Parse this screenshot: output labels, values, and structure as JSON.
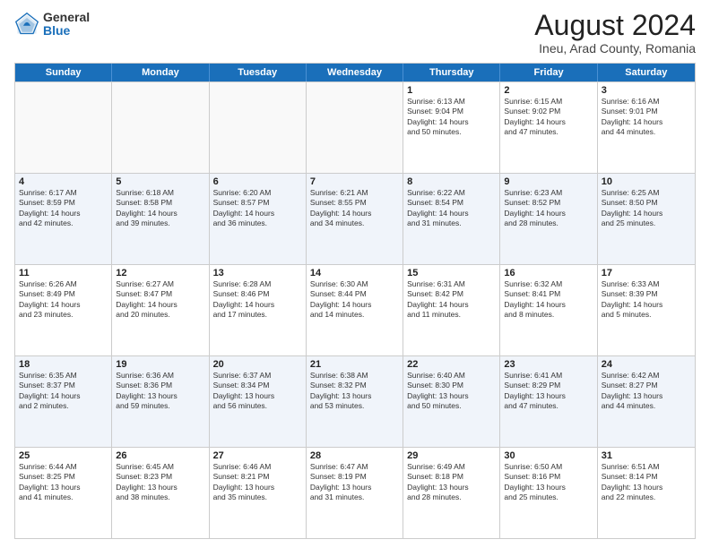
{
  "logo": {
    "general": "General",
    "blue": "Blue"
  },
  "title": "August 2024",
  "location": "Ineu, Arad County, Romania",
  "header_days": [
    "Sunday",
    "Monday",
    "Tuesday",
    "Wednesday",
    "Thursday",
    "Friday",
    "Saturday"
  ],
  "rows": [
    [
      {
        "day": "",
        "info": "",
        "empty": true
      },
      {
        "day": "",
        "info": "",
        "empty": true
      },
      {
        "day": "",
        "info": "",
        "empty": true
      },
      {
        "day": "",
        "info": "",
        "empty": true
      },
      {
        "day": "1",
        "info": "Sunrise: 6:13 AM\nSunset: 9:04 PM\nDaylight: 14 hours\nand 50 minutes."
      },
      {
        "day": "2",
        "info": "Sunrise: 6:15 AM\nSunset: 9:02 PM\nDaylight: 14 hours\nand 47 minutes."
      },
      {
        "day": "3",
        "info": "Sunrise: 6:16 AM\nSunset: 9:01 PM\nDaylight: 14 hours\nand 44 minutes."
      }
    ],
    [
      {
        "day": "4",
        "info": "Sunrise: 6:17 AM\nSunset: 8:59 PM\nDaylight: 14 hours\nand 42 minutes."
      },
      {
        "day": "5",
        "info": "Sunrise: 6:18 AM\nSunset: 8:58 PM\nDaylight: 14 hours\nand 39 minutes."
      },
      {
        "day": "6",
        "info": "Sunrise: 6:20 AM\nSunset: 8:57 PM\nDaylight: 14 hours\nand 36 minutes."
      },
      {
        "day": "7",
        "info": "Sunrise: 6:21 AM\nSunset: 8:55 PM\nDaylight: 14 hours\nand 34 minutes."
      },
      {
        "day": "8",
        "info": "Sunrise: 6:22 AM\nSunset: 8:54 PM\nDaylight: 14 hours\nand 31 minutes."
      },
      {
        "day": "9",
        "info": "Sunrise: 6:23 AM\nSunset: 8:52 PM\nDaylight: 14 hours\nand 28 minutes."
      },
      {
        "day": "10",
        "info": "Sunrise: 6:25 AM\nSunset: 8:50 PM\nDaylight: 14 hours\nand 25 minutes."
      }
    ],
    [
      {
        "day": "11",
        "info": "Sunrise: 6:26 AM\nSunset: 8:49 PM\nDaylight: 14 hours\nand 23 minutes."
      },
      {
        "day": "12",
        "info": "Sunrise: 6:27 AM\nSunset: 8:47 PM\nDaylight: 14 hours\nand 20 minutes."
      },
      {
        "day": "13",
        "info": "Sunrise: 6:28 AM\nSunset: 8:46 PM\nDaylight: 14 hours\nand 17 minutes."
      },
      {
        "day": "14",
        "info": "Sunrise: 6:30 AM\nSunset: 8:44 PM\nDaylight: 14 hours\nand 14 minutes."
      },
      {
        "day": "15",
        "info": "Sunrise: 6:31 AM\nSunset: 8:42 PM\nDaylight: 14 hours\nand 11 minutes."
      },
      {
        "day": "16",
        "info": "Sunrise: 6:32 AM\nSunset: 8:41 PM\nDaylight: 14 hours\nand 8 minutes."
      },
      {
        "day": "17",
        "info": "Sunrise: 6:33 AM\nSunset: 8:39 PM\nDaylight: 14 hours\nand 5 minutes."
      }
    ],
    [
      {
        "day": "18",
        "info": "Sunrise: 6:35 AM\nSunset: 8:37 PM\nDaylight: 14 hours\nand 2 minutes."
      },
      {
        "day": "19",
        "info": "Sunrise: 6:36 AM\nSunset: 8:36 PM\nDaylight: 13 hours\nand 59 minutes."
      },
      {
        "day": "20",
        "info": "Sunrise: 6:37 AM\nSunset: 8:34 PM\nDaylight: 13 hours\nand 56 minutes."
      },
      {
        "day": "21",
        "info": "Sunrise: 6:38 AM\nSunset: 8:32 PM\nDaylight: 13 hours\nand 53 minutes."
      },
      {
        "day": "22",
        "info": "Sunrise: 6:40 AM\nSunset: 8:30 PM\nDaylight: 13 hours\nand 50 minutes."
      },
      {
        "day": "23",
        "info": "Sunrise: 6:41 AM\nSunset: 8:29 PM\nDaylight: 13 hours\nand 47 minutes."
      },
      {
        "day": "24",
        "info": "Sunrise: 6:42 AM\nSunset: 8:27 PM\nDaylight: 13 hours\nand 44 minutes."
      }
    ],
    [
      {
        "day": "25",
        "info": "Sunrise: 6:44 AM\nSunset: 8:25 PM\nDaylight: 13 hours\nand 41 minutes."
      },
      {
        "day": "26",
        "info": "Sunrise: 6:45 AM\nSunset: 8:23 PM\nDaylight: 13 hours\nand 38 minutes."
      },
      {
        "day": "27",
        "info": "Sunrise: 6:46 AM\nSunset: 8:21 PM\nDaylight: 13 hours\nand 35 minutes."
      },
      {
        "day": "28",
        "info": "Sunrise: 6:47 AM\nSunset: 8:19 PM\nDaylight: 13 hours\nand 31 minutes."
      },
      {
        "day": "29",
        "info": "Sunrise: 6:49 AM\nSunset: 8:18 PM\nDaylight: 13 hours\nand 28 minutes."
      },
      {
        "day": "30",
        "info": "Sunrise: 6:50 AM\nSunset: 8:16 PM\nDaylight: 13 hours\nand 25 minutes."
      },
      {
        "day": "31",
        "info": "Sunrise: 6:51 AM\nSunset: 8:14 PM\nDaylight: 13 hours\nand 22 minutes."
      }
    ]
  ]
}
